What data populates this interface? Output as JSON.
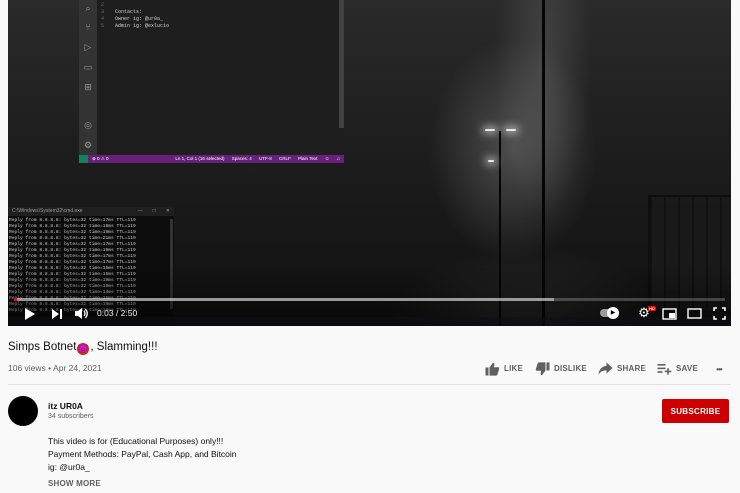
{
  "player": {
    "time_current": "0:03",
    "time_separator": " / ",
    "time_total": "2:50",
    "progress_played_fraction": 0.004,
    "progress_loaded_fraction": 0.76,
    "hd_badge": "HD",
    "autoplay_on": true
  },
  "vscode": {
    "lines": [
      {
        "num": "2",
        "text": ""
      },
      {
        "num": "3",
        "text": "Contacts:"
      },
      {
        "num": "4",
        "text": "Owner ig: @ur0a_"
      },
      {
        "num": "5",
        "text": "Admin ig: @exlucio"
      }
    ],
    "status_left": "⊗ 0 ⚠ 0",
    "status_items": [
      "Ln 1, Col 1 (16 selected)",
      "Spaces: 4",
      "UTF-8",
      "CRLF",
      "Plain Text"
    ]
  },
  "terminal": {
    "title": "C:\\Windows\\System32\\cmd.exe",
    "lines": [
      "Reply from 8.8.8.8: bytes=32 time=17ms TTL=119",
      "Reply from 8.8.8.8: bytes=32 time=18ms TTL=119",
      "Reply from 8.8.8.8: bytes=32 time=19ms TTL=119",
      "Reply from 8.8.8.8: bytes=32 time=21ms TTL=119",
      "Reply from 8.8.8.8: bytes=32 time=17ms TTL=119",
      "Reply from 8.8.8.8: bytes=32 time=19ms TTL=119",
      "Reply from 8.8.8.8: bytes=32 time=17ms TTL=119",
      "Reply from 8.8.8.8: bytes=32 time=17ms TTL=119",
      "Reply from 8.8.8.8: bytes=32 time=15ms TTL=119",
      "Reply from 8.8.8.8: bytes=32 time=16ms TTL=119",
      "Reply from 8.8.8.8: bytes=32 time=19ms TTL=119",
      "Reply from 8.8.8.8: bytes=32 time=19ms TTL=119",
      "Reply from 8.8.8.8: bytes=32 time=14ms TTL=119",
      "Reply from 8.8.8.8: bytes=32 time=15ms TTL=119",
      "Reply from 8.8.8.8: bytes=32 time=19ms TTL=119",
      "Reply from 8.8.8.8: bytes=32 time=18ms TTL=119"
    ]
  },
  "video": {
    "title_part1": "Simps Botnet",
    "title_emoji": "😈",
    "title_part2": ", Slamming!!!",
    "views": "106 views",
    "meta_separator": " • ",
    "date": "Apr 24, 2021"
  },
  "actions": {
    "like": "LIKE",
    "dislike": "DISLIKE",
    "share": "SHARE",
    "save": "SAVE",
    "more": "•••"
  },
  "channel": {
    "name": "itz UR0A",
    "subscribers": "34 subscribers",
    "subscribe_label": "SUBSCRIBE"
  },
  "description": {
    "lines": [
      "This video is for (Educational Purposes) only!!!",
      "Payment Methods: PayPal, Cash App, and Bitcoin",
      "ig: @ur0a_"
    ],
    "show_more": "SHOW MORE"
  },
  "colors": {
    "progress_played": "#ff0000",
    "subscribe_bg": "#cc0000",
    "vscode_status": "#68217a"
  }
}
